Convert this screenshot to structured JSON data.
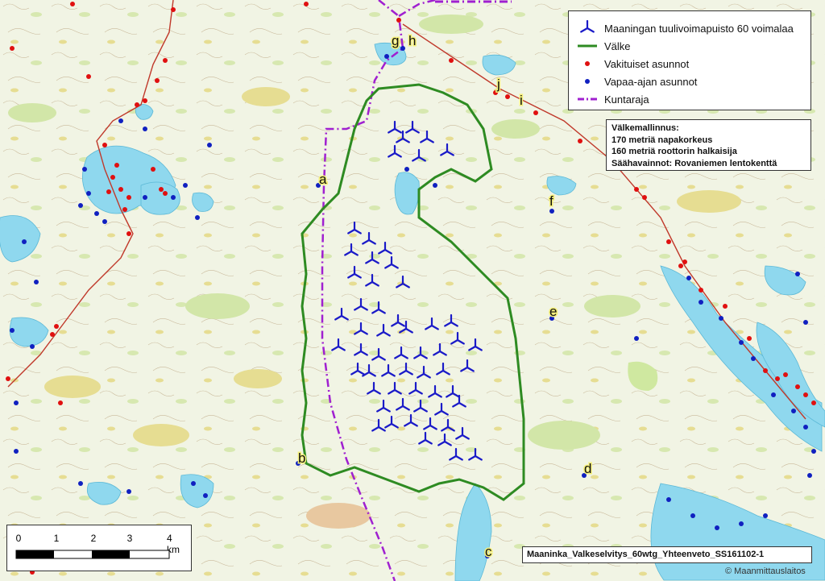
{
  "legend": {
    "turbines": "Maaningan tuulivoimapuisto 60 voimalaa",
    "flicker": "Välke",
    "permanent": "Vakituiset asunnot",
    "holiday": "Vapaa-ajan asunnot",
    "border": "Kuntaraja"
  },
  "model_info": {
    "title": "Välkemallinnus:",
    "hub_height": "170 metriä napakorkeus",
    "rotor": "160 metriä roottorin halkaisija",
    "weather": "Säähavainnot: Rovaniemen lentokenttä"
  },
  "scale": {
    "ticks": [
      "0",
      "1",
      "2",
      "3",
      "4 km"
    ]
  },
  "document_id": "Maaninka_Valkeselvitys_60wtg_Yhteenveto_SS161102-1",
  "copyright": "© Maanmittauslaitos",
  "point_labels": [
    "a",
    "b",
    "c",
    "d",
    "e",
    "f",
    "g",
    "h",
    "i",
    "j"
  ],
  "turbine_count": 60,
  "colors": {
    "turbine": "#1a1ac8",
    "flicker": "#2e8b22",
    "permanent": "#e01010",
    "holiday": "#1020c0",
    "border": "#a020d0",
    "water": "#8fd8ee",
    "field": "#e8d77a",
    "forest_green": "#b8d98a"
  },
  "icons": [
    "turbine-icon",
    "line-icon",
    "dot-icon"
  ]
}
